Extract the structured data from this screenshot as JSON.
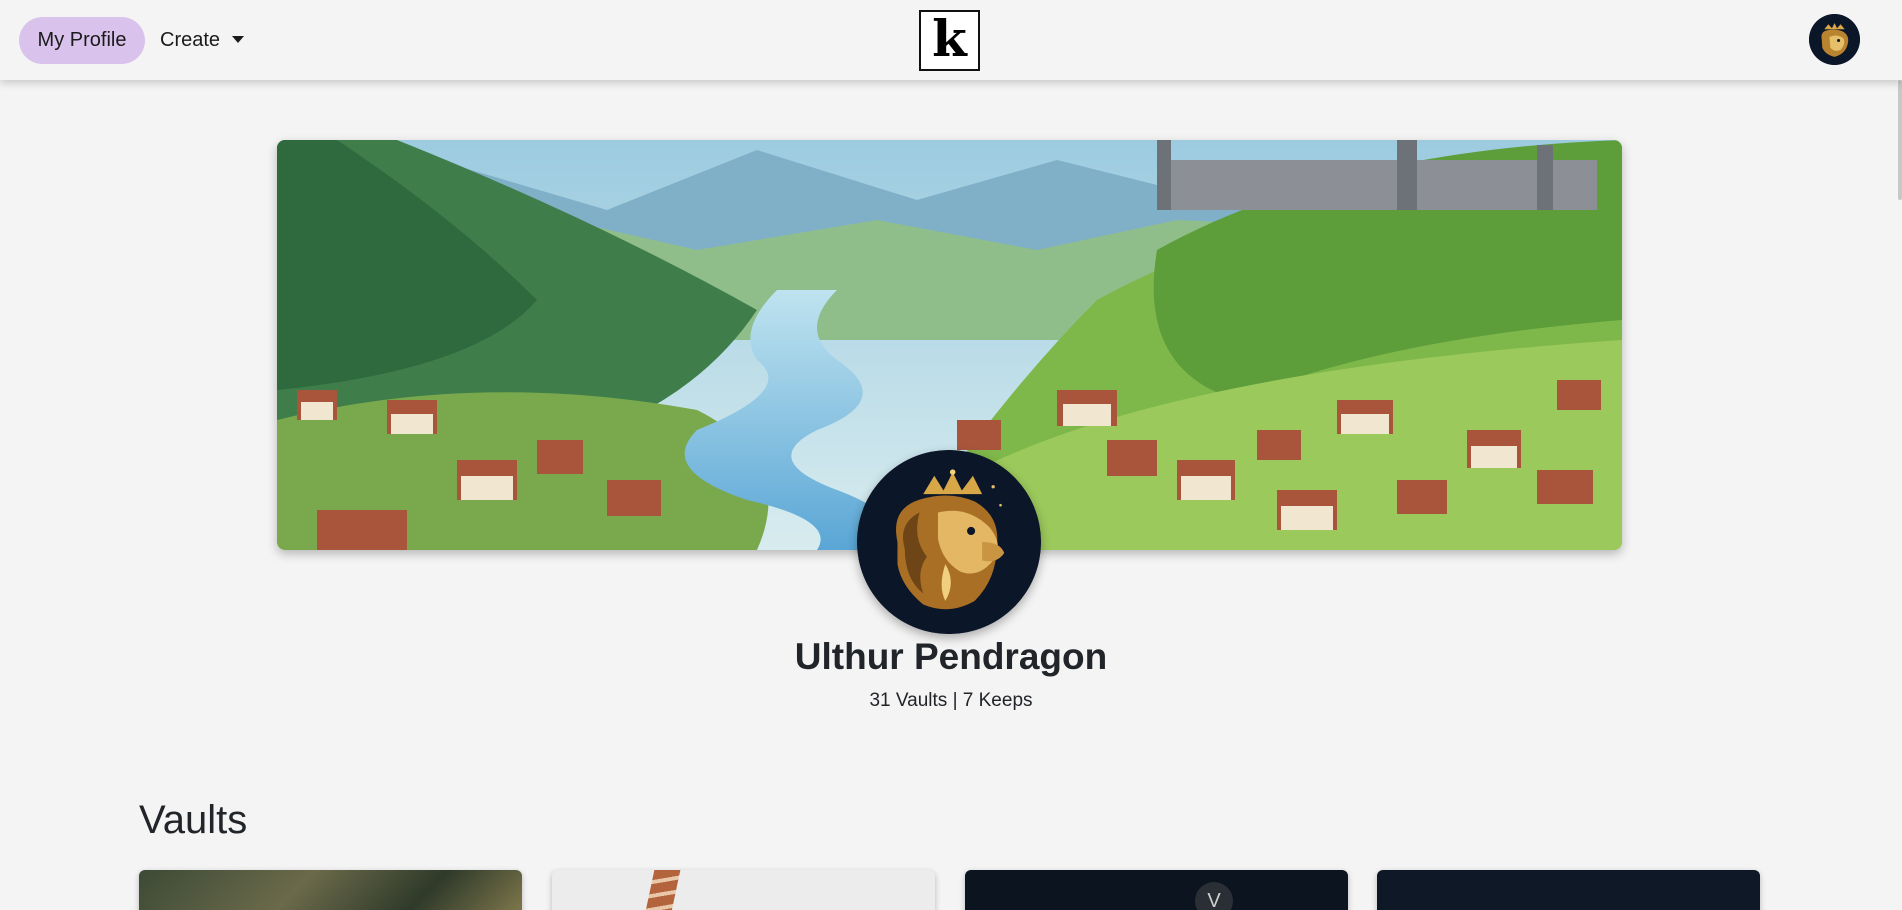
{
  "navbar": {
    "profile_label": "My Profile",
    "create_label": "Create",
    "logo_letter": "k"
  },
  "profile": {
    "name": "Ulthur Pendragon",
    "stats": "31 Vaults | 7 Keeps"
  },
  "vaults_section": {
    "title": "Vaults",
    "cards": [
      {
        "image": "foliage-photo"
      },
      {
        "image": "giraffe-photo"
      },
      {
        "image": "dark-photo",
        "badge": "V"
      },
      {
        "image": "dark-photo"
      }
    ]
  },
  "colors": {
    "accent": "#d9c3ec",
    "background": "#f4f4f4",
    "avatar_bg": "#0b1628",
    "lion_gold": "#d8a848"
  }
}
